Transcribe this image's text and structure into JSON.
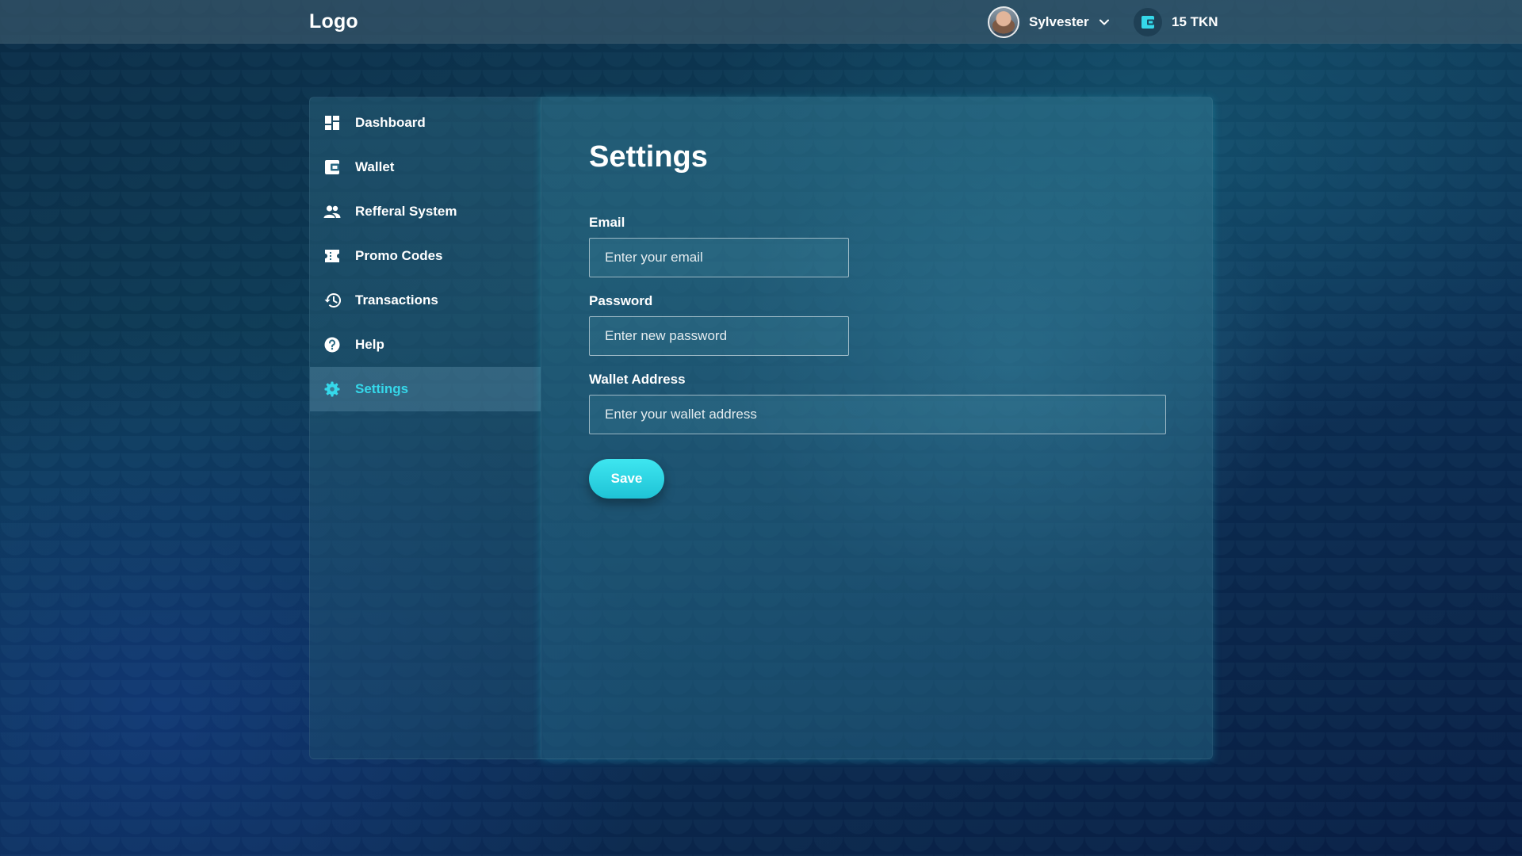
{
  "header": {
    "logo": "Logo",
    "user": {
      "name": "Sylvester",
      "avatar_icon": "user-avatar"
    },
    "balance": {
      "amount": "15 TKN",
      "icon": "wallet-icon"
    }
  },
  "sidebar": {
    "items": [
      {
        "label": "Dashboard",
        "icon": "dashboard-icon",
        "active": false
      },
      {
        "label": "Wallet",
        "icon": "wallet-icon",
        "active": false
      },
      {
        "label": "Refferal System",
        "icon": "people-icon",
        "active": false
      },
      {
        "label": "Promo Codes",
        "icon": "ticket-icon",
        "active": false
      },
      {
        "label": "Transactions",
        "icon": "history-icon",
        "active": false
      },
      {
        "label": "Help",
        "icon": "help-icon",
        "active": false
      },
      {
        "label": "Settings",
        "icon": "gear-icon",
        "active": true
      }
    ]
  },
  "main": {
    "title": "Settings",
    "form": {
      "email": {
        "label": "Email",
        "value": "",
        "placeholder": "Enter your email"
      },
      "password": {
        "label": "Password",
        "value": "",
        "placeholder": "Enter new password"
      },
      "wallet_address": {
        "label": "Wallet Address",
        "value": "",
        "placeholder": "Enter your wallet address"
      },
      "save_label": "Save"
    }
  },
  "colors": {
    "accent": "#35d8ea",
    "button": "#2fd6e6",
    "topbar": "#38566a"
  }
}
